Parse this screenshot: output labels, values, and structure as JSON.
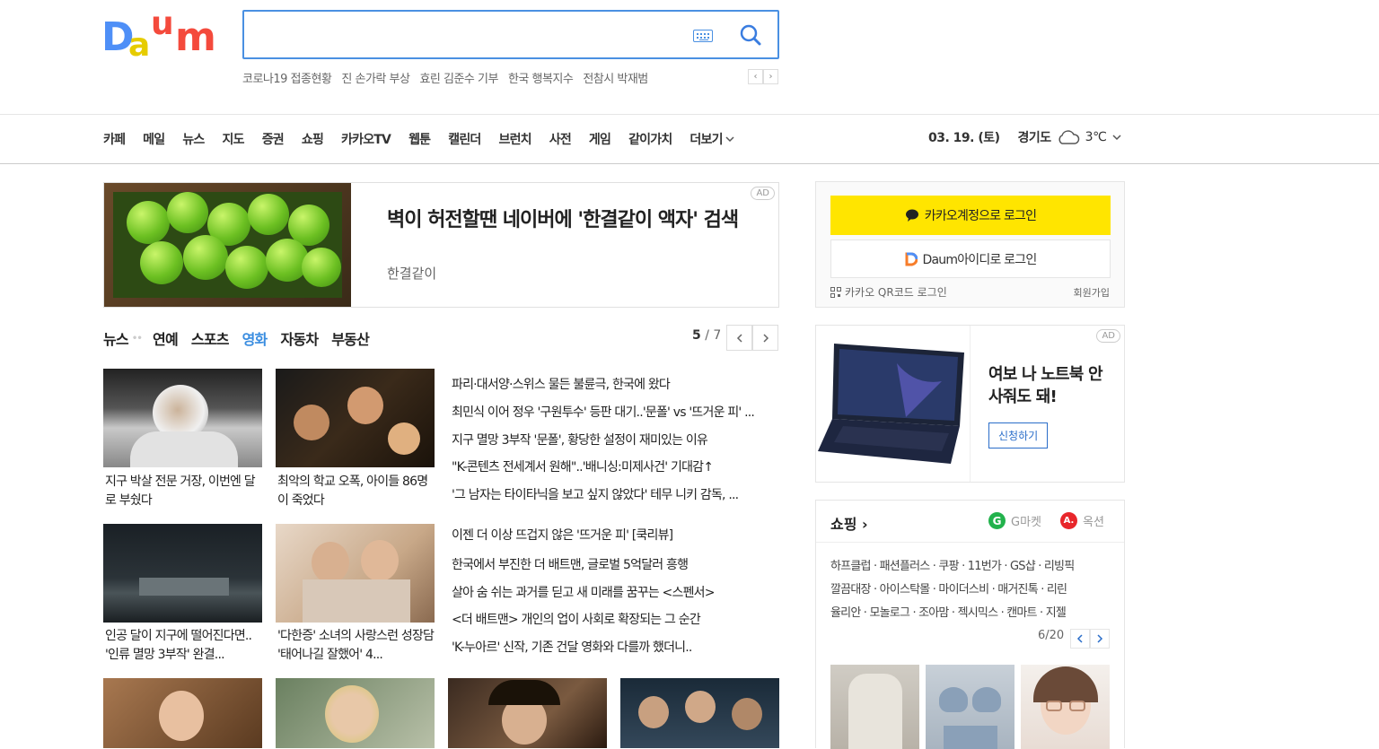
{
  "search": {
    "placeholder": ""
  },
  "trending": [
    "코로나19 접종현황",
    "진 손가락 부상",
    "효린 김준수 기부",
    "한국 행복지수",
    "전참시 박재범"
  ],
  "trend_nav": {
    "prev": "‹",
    "next": "›"
  },
  "nav": [
    "카페",
    "메일",
    "뉴스",
    "지도",
    "증권",
    "쇼핑",
    "카카오TV",
    "웹툰",
    "캘린더",
    "브런치",
    "사전",
    "게임",
    "같이가치",
    "더보기"
  ],
  "weather": {
    "date": "03. 19. (토)",
    "region": "경기도",
    "temp": "3℃"
  },
  "ad_banner": {
    "title": "벽이 허전할땐 네이버에 '한결같이 액자' 검색",
    "sub": "한결같이",
    "badge": "AD"
  },
  "news": {
    "tabs": [
      "뉴스",
      "연예",
      "스포츠",
      "영화",
      "자동차",
      "부동산"
    ],
    "active_tab": "영화",
    "page": "5",
    "total": "/ 7",
    "thumb_captions": [
      "지구 박살 전문 거장, 이번엔 달로 부쉈다",
      "최악의 학교 오폭, 아이들 86명이 죽었다",
      "인공 달이 지구에 떨어진다면.. '인류 멸망 3부작' 완결...",
      "'다한증' 소녀의 사랑스런 성장담 '태어나길 잘했어' 4..."
    ],
    "headlines": [
      "파리·대서양·스위스 물든 불륜극, 한국에 왔다",
      "최민식 이어 정우 '구원투수' 등판 대기..'문폴' vs '뜨거운 피' ...",
      "지구 멸망 3부작 '문폴', 황당한 설정이 재미있는 이유",
      "\"K-콘텐츠 전세계서 원해\"..'배니싱:미제사건' 기대감↑",
      "'그 남자는 타이타닉을 보고 싶지 않았다' 테무 니키 감독, ...",
      "이젠 더 이상 뜨겁지 않은 '뜨거운 피' [쿡리뷰]",
      "한국에서 부진한 더 배트맨, 글로벌 5억달러 흥행",
      "살아 숨 쉬는 과거를 딛고 새 미래를 꿈꾸는 <스펜서>",
      "<더 배트맨> 개인의 업이 사회로 확장되는 그 순간",
      "'K-누아르' 신작, 기존 건달 영화와 다를까 했더니.."
    ]
  },
  "login": {
    "kakao": "카카오계정으로 로그인",
    "daum": "Daum아이디로 로그인",
    "qr": "카카오 QR코드 로그인",
    "signup": "회원가입"
  },
  "side_ad": {
    "title": "여보 나 노트북 안 사줘도 돼!",
    "button": "신청하기",
    "badge": "AD"
  },
  "shopping": {
    "title": "쇼핑 ›",
    "partners": [
      {
        "name": "G마켓",
        "icon": "G",
        "color": "#22b24c"
      },
      {
        "name": "옥션",
        "icon": "A.",
        "color": "#e8262b"
      }
    ],
    "lines": [
      "하프클럽 · 패션플러스 · 쿠팡 · 11번가 · GS샵 · 리빙픽",
      "깔끔대장 · 아이스탁몰 · 마이더스비 · 매거진톡 · 리린",
      "율리안 · 모놀로그 · 조아맘 · 젝시믹스 · 캔마트 · 지젤"
    ],
    "page": "6/20"
  }
}
